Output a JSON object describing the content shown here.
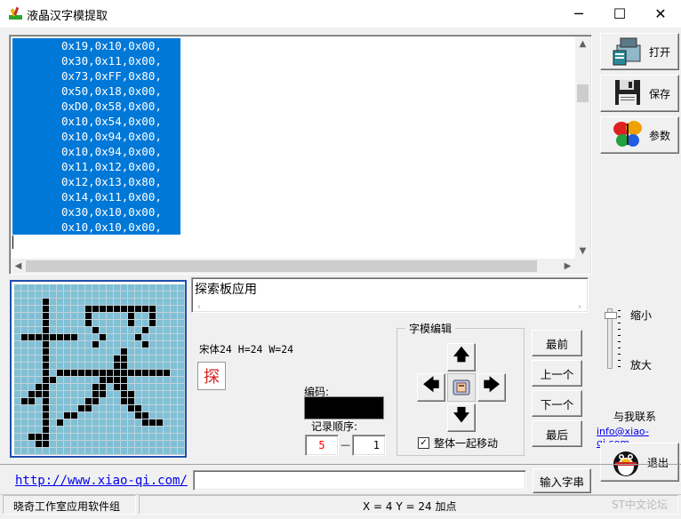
{
  "window": {
    "title": "液晶汉字模提取",
    "minimize": "─",
    "maximize": "☐",
    "close": "✕"
  },
  "code_lines": [
    "0x19,0x10,0x00,",
    "0x30,0x11,0x00,",
    "0x73,0xFF,0x80,",
    "0x50,0x18,0x00,",
    "0xD0,0x58,0x00,",
    "0x10,0x54,0x00,",
    "0x10,0x94,0x00,",
    "0x10,0x94,0x00,",
    "0x11,0x12,0x00,",
    "0x12,0x13,0x80,",
    "0x14,0x11,0x00,",
    "0x30,0x10,0x00,",
    "0x10,0x10,0x00,"
  ],
  "toolbar": {
    "open": "打开",
    "save": "保存",
    "params": "参数"
  },
  "zoom": {
    "small": "缩小",
    "large": "放大"
  },
  "contact": {
    "label": "与我联系",
    "email": "info@xiao-qi.com",
    "exit": "退出"
  },
  "text_input": {
    "value": "探索板应用"
  },
  "font_info": "宋体24 H=24 W=24",
  "preview_char": "探",
  "code_label": "编码:",
  "order_label": "记录顺序:",
  "order_first": "5",
  "order_dash": "—",
  "order_second": "1",
  "edit_group": {
    "title": "字模编辑",
    "up": "🡅",
    "down": "🡇",
    "left": "🡄",
    "right": "🡆",
    "checkbox": "✓",
    "move_all": "整体一起移动"
  },
  "nav": {
    "first": "最前",
    "prev": "上一个",
    "next": "下一个",
    "last": "最后"
  },
  "bottom": {
    "url": "http://www.xiao-qi.com/",
    "input_button": "输入字串"
  },
  "status": {
    "left": "晓奇工作室应用软件组",
    "right": "X = 4 Y = 24 加点"
  },
  "watermark": "ST中文论坛",
  "colors": {
    "selection": "#0078d7",
    "grid_off": "#7fc0d6",
    "grid_on": "#000000",
    "grid_border": "#1f4faf",
    "order_red": "#ff0000"
  },
  "bitmap": [
    "000000000000000000000000",
    "000000000000000000000000",
    "000010000000000000000000",
    "000010000011111111110000",
    "000010000010000010010000",
    "000010000010000010010000",
    "000010000001000000100000",
    "011111111000100001000000",
    "000010000001000000100000",
    "000010000000000100000000",
    "000010000000001100000000",
    "000010000000001100000000",
    "000010111111111111111100",
    "000011000000111100000000",
    "000110000001101100000000",
    "001110000001100110000000",
    "011010000011000110000000",
    "000010000110000011000000",
    "000010011000000001100000",
    "000010100000000000111000",
    "000010000000000000000000",
    "001110000000000000000000",
    "000110000000000000000000",
    "000000000000000000000000"
  ]
}
